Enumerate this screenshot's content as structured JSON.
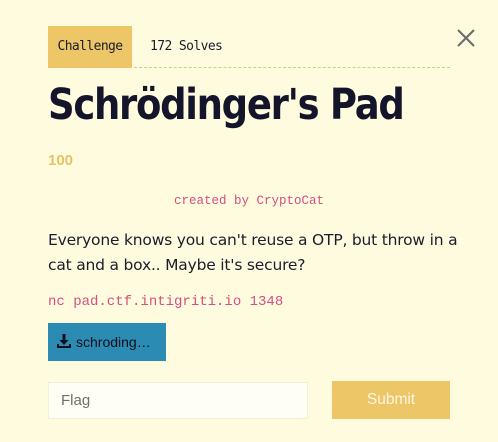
{
  "tabs": {
    "challenge_label": "Challenge",
    "solves_label": "172 Solves"
  },
  "challenge": {
    "title": "Schrödinger's Pad",
    "points": "100",
    "author": "created by CryptoCat",
    "description": "Everyone knows you can't reuse a OTP, but throw in a cat and a box.. Maybe it's secure?",
    "connection": "nc pad.ctf.intigriti.io 1348",
    "file_label": "schroding…"
  },
  "form": {
    "flag_placeholder": "Flag",
    "submit_label": "Submit"
  },
  "icons": {
    "close": "close-icon",
    "download": "download-icon"
  },
  "colors": {
    "background": "#fffbdf",
    "accent": "#ecc667",
    "link_pink": "#d34f83",
    "file_button": "#2c8bb2"
  }
}
